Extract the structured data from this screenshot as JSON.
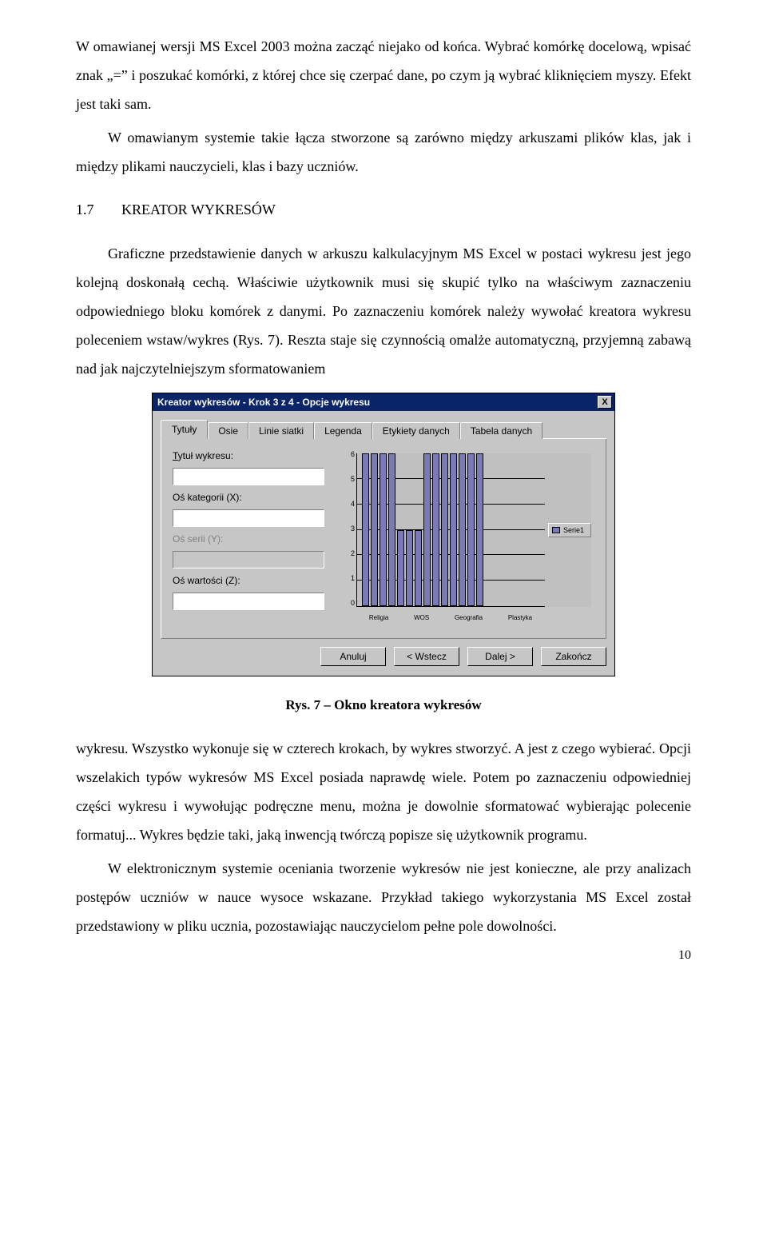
{
  "para1": "W omawianej wersji MS Excel 2003 można zacząć niejako od końca. Wybrać komórkę docelową, wpisać znak „=” i poszukać komórki, z której chce się czerpać dane, po czym ją wybrać kliknięciem myszy. Efekt jest taki sam.",
  "para2": "W omawianym systemie takie łącza stworzone są zarówno między arkuszami plików klas, jak i między plikami nauczycieli, klas i bazy uczniów.",
  "heading_num": "1.7",
  "heading_text": "KREATOR WYKRESÓW",
  "para3": "Graficzne przedstawienie danych w arkuszu kalkulacyjnym MS Excel w postaci wykresu jest jego kolejną doskonałą cechą. Właściwie użytkownik musi się skupić tylko na właściwym zaznaczeniu odpowiedniego bloku komórek z danymi. Po zaznaczeniu komórek należy wywołać kreatora wykresu poleceniem wstaw/wykres (Rys. 7). Reszta staje się czynnością omalże automatyczną, przyjemną zabawą nad jak najczytelniejszym sformatowaniem",
  "caption": "Rys. 7 – Okno kreatora wykresów",
  "para4": "wykresu. Wszystko wykonuje się w czterech krokach, by wykres stworzyć. A jest z czego wybierać. Opcji wszelakich typów wykresów MS Excel posiada naprawdę wiele. Potem po zaznaczeniu odpowiedniej części wykresu i wywołując podręczne menu, można je dowolnie sformatować wybierając polecenie formatuj... Wykres będzie taki, jaką inwencją twórczą popisze się użytkownik programu.",
  "para5": "W elektronicznym systemie oceniania tworzenie wykresów nie jest konieczne, ale przy analizach postępów uczniów w nauce wysoce wskazane. Przykład takiego wykorzystania MS Excel został przedstawiony w pliku ucznia, pozostawiając nauczycielom pełne pole dowolności.",
  "page_num": "10",
  "dialog": {
    "title": "Kreator wykresów - Krok 3 z 4 - Opcje wykresu",
    "close": "X",
    "tabs": [
      "Tytuły",
      "Osie",
      "Linie siatki",
      "Legenda",
      "Etykiety danych",
      "Tabela danych"
    ],
    "labels": {
      "chart_title": "Tytuł wykresu:",
      "cat_axis": "Oś kategorii (X):",
      "series_axis": "Oś serii (Y):",
      "value_axis": "Oś wartości (Z):"
    },
    "legend": "Serie1",
    "buttons": {
      "cancel": "Anuluj",
      "back": "< Wstecz",
      "next": "Dalej >",
      "finish": "Zakończ"
    }
  },
  "chart_data": {
    "type": "bar",
    "categories": [
      "Religia",
      "WOS",
      "Geografia",
      "Plastyka"
    ],
    "series": [
      {
        "name": "Serie1",
        "values": [
          6,
          6,
          6,
          6,
          3,
          3,
          3,
          6,
          6,
          6,
          6,
          6,
          6,
          6
        ]
      }
    ],
    "ylim": [
      0,
      6
    ],
    "y_ticks": [
      6,
      5,
      4,
      3,
      2,
      1,
      0
    ],
    "title": "",
    "xlabel": "",
    "ylabel": ""
  }
}
